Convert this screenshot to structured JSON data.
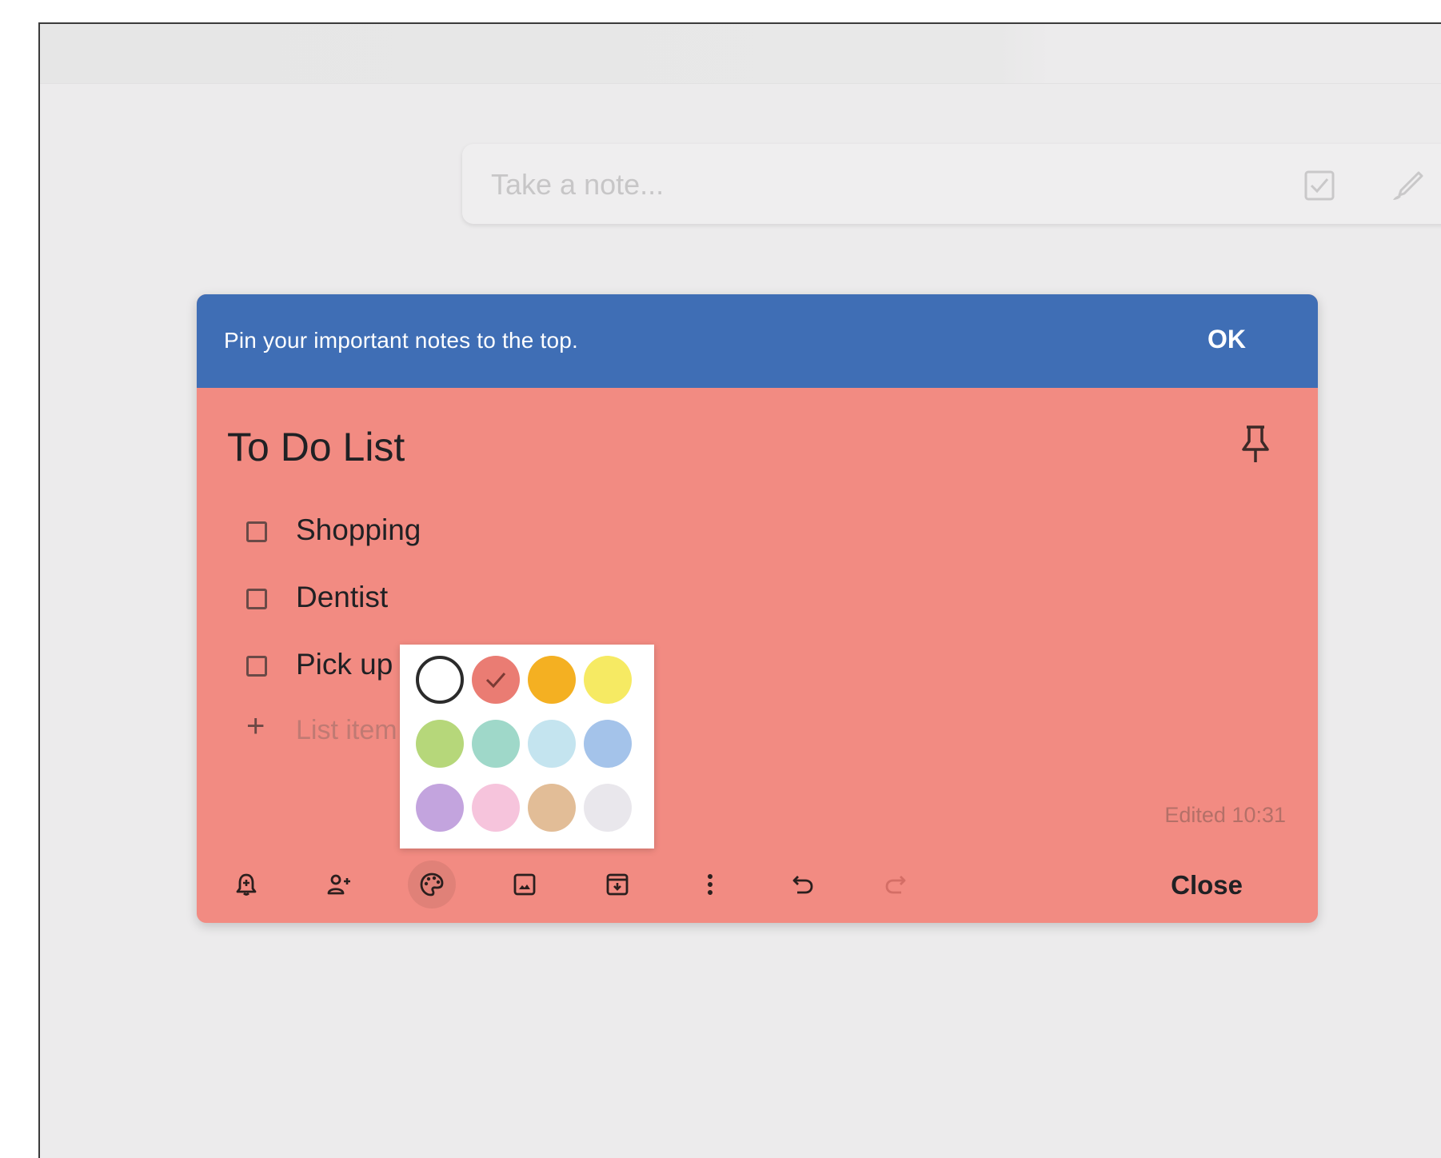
{
  "take_note": {
    "placeholder": "Take a note...",
    "icons": [
      "new-list-icon",
      "new-note-with-drawing-icon"
    ]
  },
  "tip_banner": {
    "text": "Pin your important notes to the top.",
    "ok_label": "OK",
    "color": "#3f6eb5"
  },
  "note": {
    "color": "#f28b82",
    "title": "To Do List",
    "items": [
      {
        "label": "Shopping",
        "checked": false
      },
      {
        "label": "Dentist",
        "checked": false
      },
      {
        "label": "Pick up",
        "checked": false
      }
    ],
    "add_item_placeholder": "List item",
    "edited": "Edited 10:31",
    "close_label": "Close"
  },
  "toolbar": {
    "buttons": [
      "remind-me-icon",
      "collaborator-icon",
      "palette-icon",
      "add-image-icon",
      "archive-icon",
      "more-icon",
      "undo-icon",
      "redo-icon"
    ],
    "active": "palette-icon"
  },
  "color_palette": {
    "selected": "#f28b82",
    "swatches": [
      "#ffffff",
      "#f28b82",
      "#fbbc04",
      "#fff475",
      "#ccff90",
      "#a7ffeb",
      "#cbf0f8",
      "#aecbfa",
      "#d7aefb",
      "#fdcfe8",
      "#e6c9a8",
      "#e8eaed"
    ],
    "rendered": [
      "#ffffff",
      "#ea7c73",
      "#f4b022",
      "#f6ea63",
      "#b6d77a",
      "#9fd8c9",
      "#c4e4ef",
      "#a4c3ea",
      "#c3a4de",
      "#f6c4dc",
      "#e2bd97",
      "#e9e7ec"
    ]
  }
}
